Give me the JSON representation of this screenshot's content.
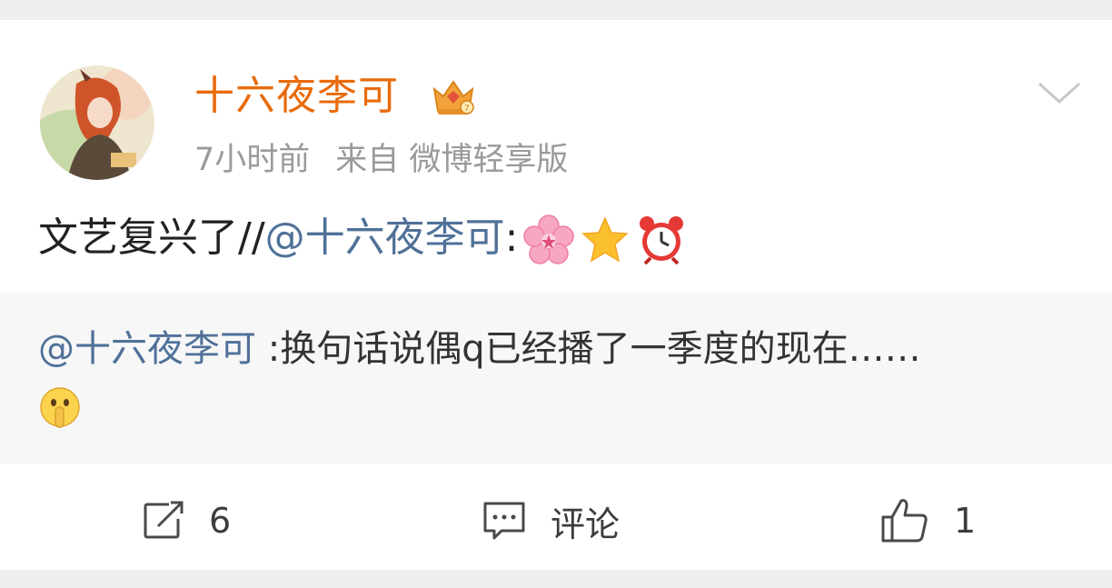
{
  "post": {
    "username": "十六夜李可",
    "time": "7小时前",
    "source": "来自 微博轻享版",
    "text_prefix": "文艺复兴了//",
    "mention": "@十六夜李可",
    "text_suffix": ":",
    "emojis": [
      "cherry-blossom-icon",
      "star-icon",
      "alarm-clock-icon"
    ]
  },
  "quote": {
    "mention": "@十六夜李可",
    "text": " :换句话说偶q已经播了一季度的现在……",
    "emoji": "shushing-face-icon"
  },
  "actions": {
    "repost_count": "6",
    "comment_label": "评论",
    "like_count": "1"
  },
  "colors": {
    "username": "#e86b0a",
    "mention": "#4f7198",
    "meta": "#9a9a9a",
    "quote_bg": "#f7f7f7"
  }
}
